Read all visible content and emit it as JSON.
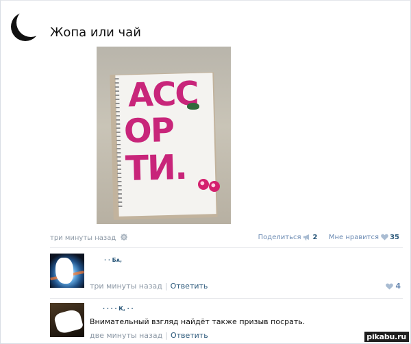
{
  "post": {
    "title": "Жопа или чай",
    "photo_text": [
      "АСС",
      "ОР",
      "ТИ."
    ],
    "time": "три минуты назад",
    "share_label": "Поделиться",
    "share_count": "2",
    "like_label": "Мне нравится",
    "like_count": "35"
  },
  "comments": [
    {
      "author": "· · Бᴀ,",
      "time": "три минуты назад",
      "reply_label": "Ответить",
      "likes": "4"
    },
    {
      "author": "· · · ·  К,  ·  ·",
      "text": "Внимательный взгляд найдёт также призыв посрать.",
      "time": "две минуты назад",
      "reply_label": "Ответить"
    }
  ],
  "watermark": "pikabu.ru",
  "colors": {
    "link": "#2b587a",
    "muted": "#8d99a6",
    "accent_pink": "#c8257a"
  },
  "icons": [
    "gear-icon",
    "megaphone-icon",
    "heart-icon"
  ]
}
